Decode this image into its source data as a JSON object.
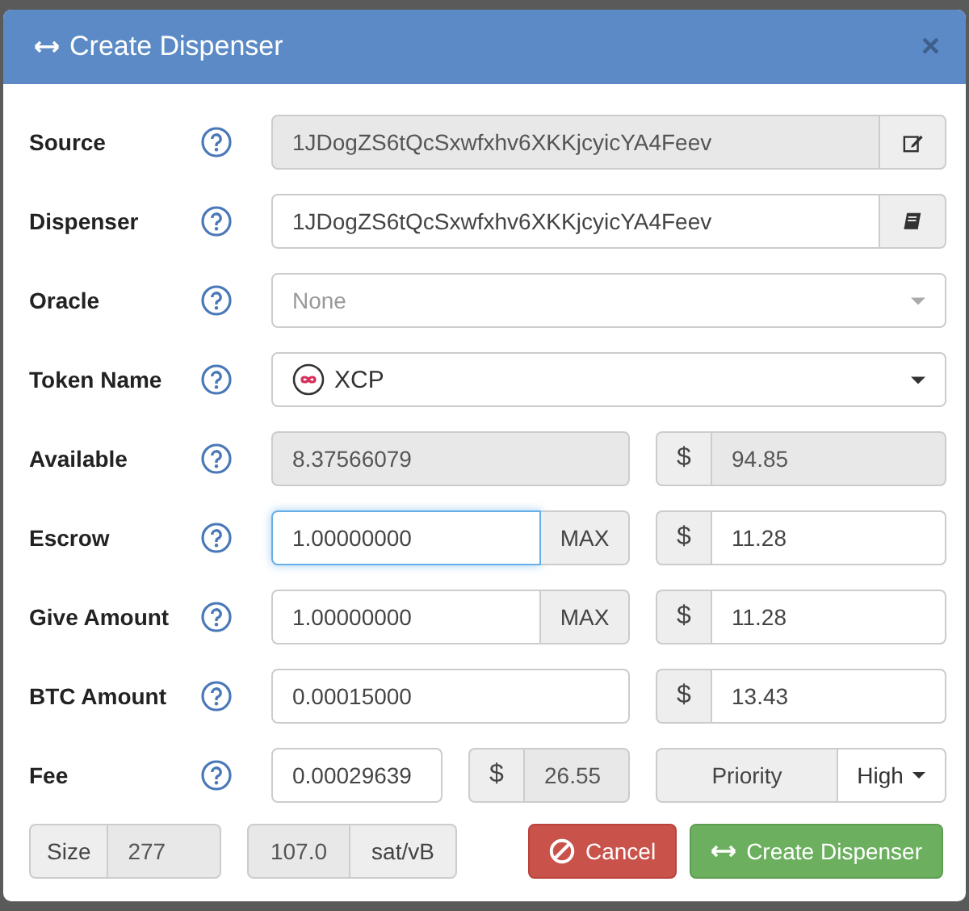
{
  "dialog": {
    "title": "Create Dispenser",
    "close": "×"
  },
  "rows": [
    {
      "kind": "edit-address",
      "label": "Source",
      "value": "1JDogZS6tQcSxwfxhv6XKKjcyicYA4Feev",
      "readonly": true
    },
    {
      "kind": "book-address",
      "label": "Dispenser",
      "value": "1JDogZS6tQcSxwfxhv6XKKjcyicYA4Feev",
      "readonly": false
    },
    {
      "kind": "select",
      "label": "Oracle",
      "placeholder": "None"
    },
    {
      "kind": "token",
      "label": "Token Name",
      "value": "XCP"
    },
    {
      "kind": "amount",
      "label": "Available",
      "value": "8.37566079",
      "readonly": true,
      "focused": false,
      "currency": "$",
      "usd_value": "94.85",
      "usd_readonly": true
    },
    {
      "kind": "amount",
      "label": "Escrow",
      "value": "1.00000000",
      "readonly": false,
      "focused": true,
      "max": "MAX",
      "currency": "$",
      "usd_value": "11.28",
      "usd_readonly": false
    },
    {
      "kind": "amount",
      "label": "Give Amount",
      "value": "1.00000000",
      "readonly": false,
      "focused": false,
      "max": "MAX",
      "currency": "$",
      "usd_value": "11.28",
      "usd_readonly": false
    },
    {
      "kind": "amount",
      "label": "BTC Amount",
      "value": "0.00015000",
      "readonly": false,
      "focused": false,
      "currency": "$",
      "usd_value": "13.43",
      "usd_readonly": false
    },
    {
      "kind": "fee",
      "label": "Fee",
      "value": "0.00029639",
      "currency": "$",
      "usd_value": "26.55",
      "priority_label": "Priority",
      "priority": "High"
    }
  ],
  "footer": {
    "size_label": "Size",
    "size": "277",
    "rate": "107.0",
    "rate_unit": "sat/vB",
    "cancel": "Cancel",
    "submit": "Create Dispenser"
  }
}
